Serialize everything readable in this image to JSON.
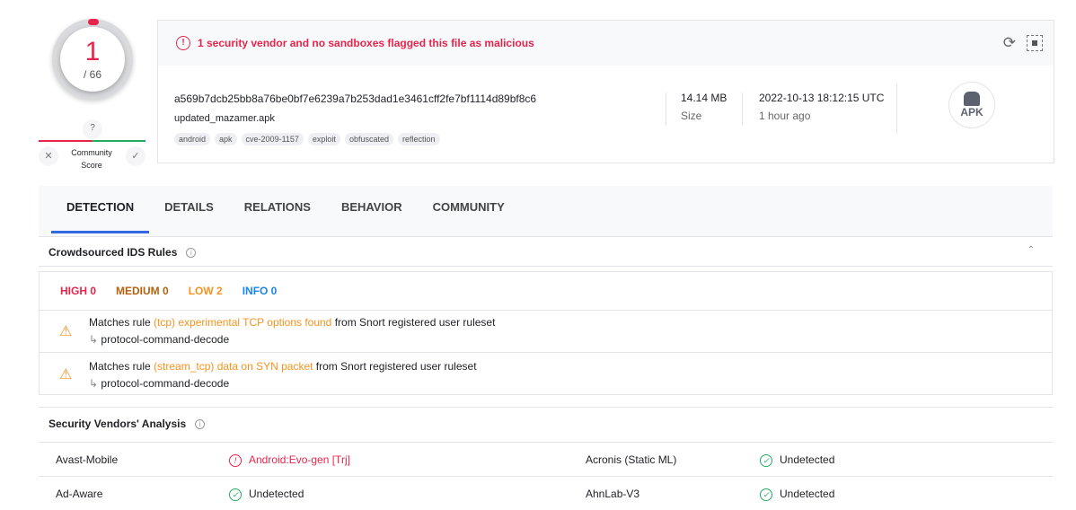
{
  "score": {
    "detections": "1",
    "total": "/ 66"
  },
  "community": {
    "question": "?",
    "label": "Community Score",
    "dislike": "✕",
    "like": "✓"
  },
  "banner": {
    "icon": "!",
    "text": "1 security vendor and no sandboxes flagged this file as malicious"
  },
  "file": {
    "hash": "a569b7dcb25bb8a76be0bf7e6239a7b253dad1e3461cff2fe7bf1114d89bf8c6",
    "name": "updated_mazamer.apk",
    "tags": [
      "android",
      "apk",
      "cve-2009-1157",
      "exploit",
      "obfuscated",
      "reflection"
    ],
    "size": "14.14 MB",
    "size_label": "Size",
    "date": "2022-10-13 18:12:15 UTC",
    "date_relative": "1 hour ago",
    "type": "APK"
  },
  "tabs": [
    "DETECTION",
    "DETAILS",
    "RELATIONS",
    "BEHAVIOR",
    "COMMUNITY"
  ],
  "ids": {
    "title": "Crowdsourced IDS Rules",
    "counts": {
      "high": "HIGH 0",
      "medium": "MEDIUM 0",
      "low": "LOW 2",
      "info": "INFO 0"
    },
    "rules": [
      {
        "prefix": "Matches rule ",
        "rule": "(tcp) experimental TCP options found",
        "suffix": " from Snort registered user ruleset",
        "category": "protocol-command-decode"
      },
      {
        "prefix": "Matches rule ",
        "rule": "(stream_tcp) data on SYN packet",
        "suffix": " from Snort registered user ruleset",
        "category": "protocol-command-decode"
      }
    ]
  },
  "vendors": {
    "title": "Security Vendors' Analysis",
    "rows": [
      {
        "v1": "Avast-Mobile",
        "r1": "Android:Evo-gen [Trj]",
        "v2": "Acronis (Static ML)",
        "r2": "Undetected"
      },
      {
        "v1": "Ad-Aware",
        "r1": "Undetected",
        "v2": "AhnLab-V3",
        "r2": "Undetected"
      }
    ]
  },
  "colors": {
    "malicious": "#e8244c",
    "clean": "#27a864",
    "low": "#f5931f",
    "medium": "#b2620e",
    "info": "#1a88e8",
    "tab_accent": "#3468e3"
  }
}
